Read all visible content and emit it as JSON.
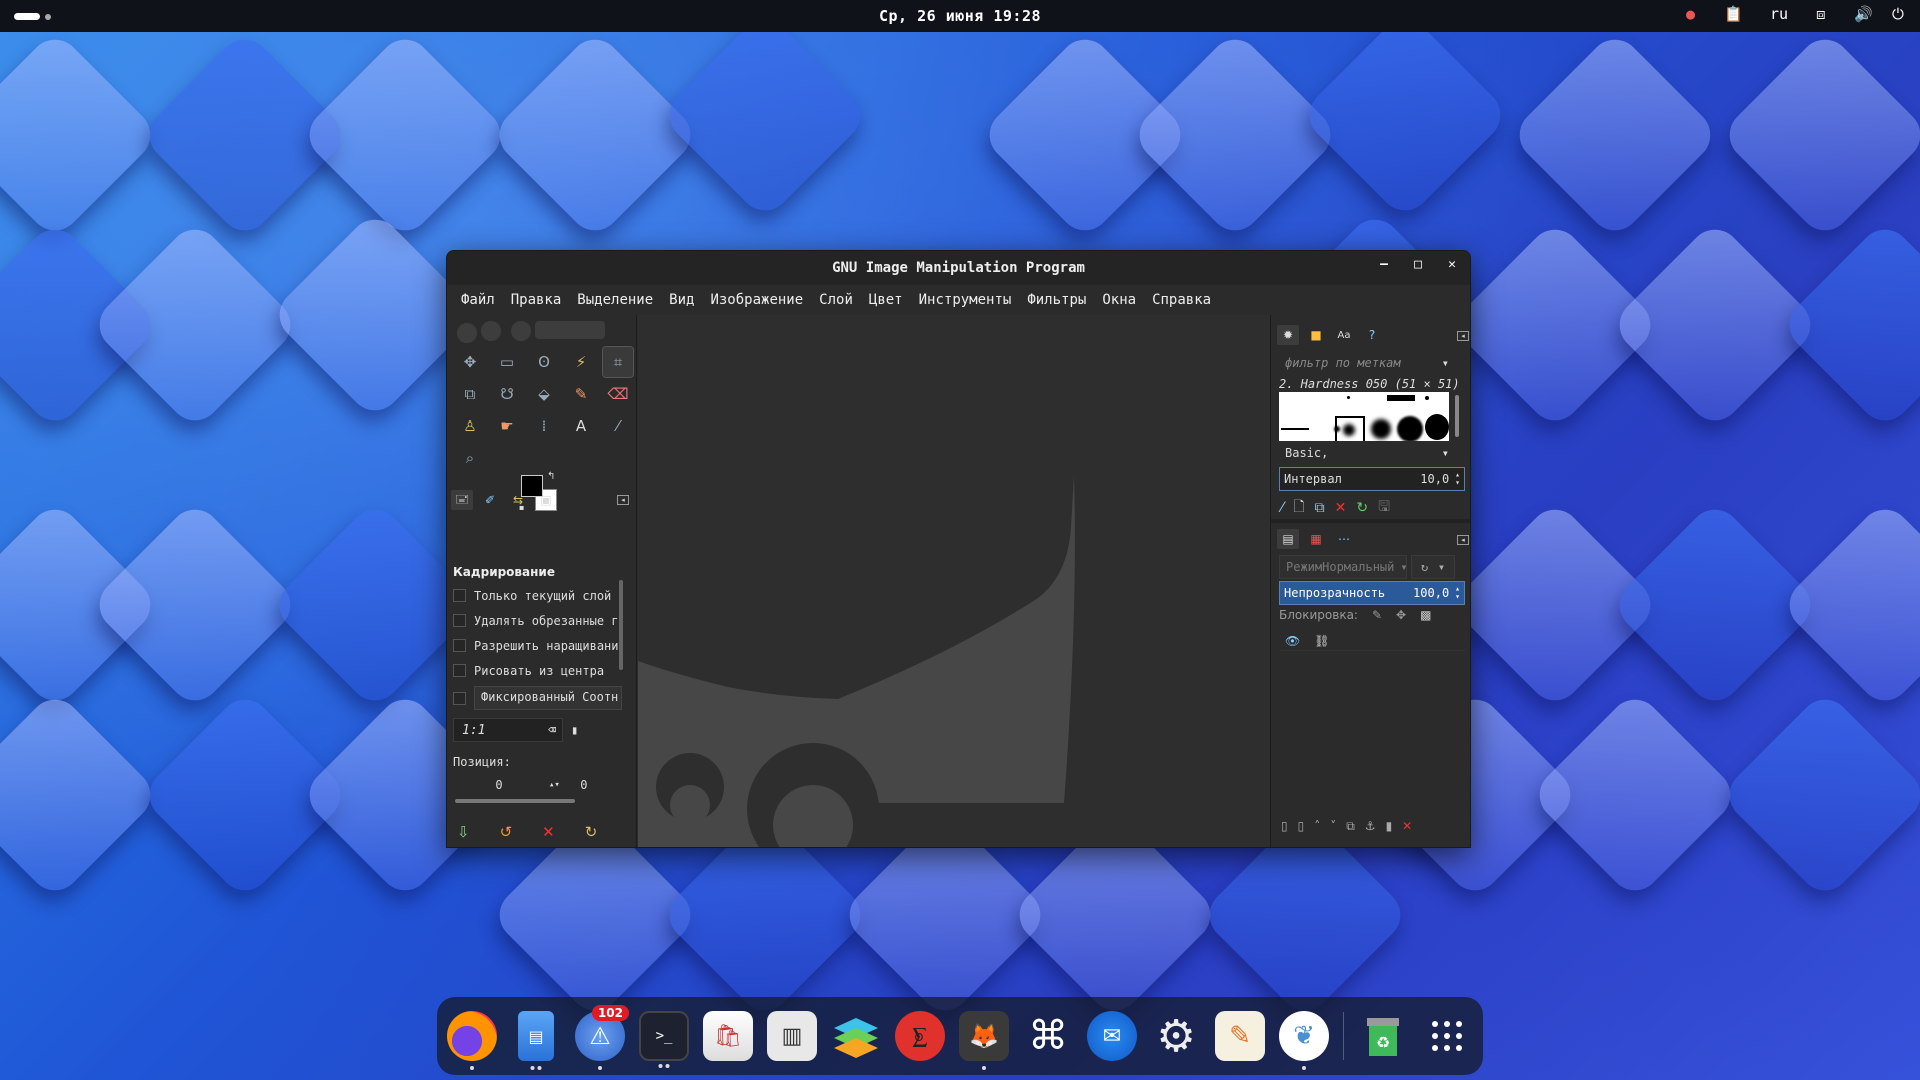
{
  "topbar": {
    "clock": "Ср, 26 июня 19:28",
    "keyboard_layout": "ru"
  },
  "window": {
    "title": "GNU Image Manipulation Program",
    "minimize_label": "–",
    "maximize_label": "□",
    "close_label": "✕"
  },
  "menu": {
    "items": [
      "Файл",
      "Правка",
      "Выделение",
      "Вид",
      "Изображение",
      "Слой",
      "Цвет",
      "Инструменты",
      "Фильтры",
      "Окна",
      "Справка"
    ]
  },
  "tool_options": {
    "title": "Кадрирование",
    "current_layer_only": "Только текущий слой",
    "delete_cropped": "Удалять обрезанные г",
    "allow_growing": "Разрешить наращивани",
    "expand_from_center": "Рисовать из центра",
    "fixed_combo": "Фиксированный Соотн",
    "ratio_value": "1:1",
    "position_label": "Позиция:",
    "pos_x": "0",
    "pos_y": "0"
  },
  "brushes": {
    "filter_placeholder": "фильтр по меткам",
    "current_brush": "2. Hardness 050 (51 × 51)",
    "tag_combo": "Basic,",
    "spacing_label": "Интервал",
    "spacing_value": "10,0"
  },
  "layers": {
    "mode_label": "Режим",
    "mode_value": "Нормальный",
    "opacity_label": "Непрозрачность",
    "opacity_value": "100,0",
    "lock_label": "Блокировка:"
  },
  "dock": {
    "apps": [
      {
        "name": "firefox",
        "icon": "firefox-icon"
      },
      {
        "name": "files",
        "icon": "files-icon"
      },
      {
        "name": "updates",
        "icon": "updates-icon",
        "badge": "102"
      },
      {
        "name": "terminal",
        "icon": "terminal-icon"
      },
      {
        "name": "store",
        "icon": "store-icon"
      },
      {
        "name": "monitor",
        "icon": "system-monitor-icon"
      },
      {
        "name": "layers",
        "icon": "layers-app-icon"
      },
      {
        "name": "app-red",
        "icon": "red-app-icon"
      },
      {
        "name": "gimp",
        "icon": "gimp-icon"
      },
      {
        "name": "screenshot",
        "icon": "screenshot-icon"
      },
      {
        "name": "thunderbird",
        "icon": "thunderbird-icon"
      },
      {
        "name": "settings",
        "icon": "settings-icon"
      },
      {
        "name": "text-editor",
        "icon": "text-editor-icon"
      },
      {
        "name": "coral",
        "icon": "coral-app-icon"
      },
      {
        "name": "trash",
        "icon": "trash-icon"
      },
      {
        "name": "app-grid",
        "icon": "app-grid-icon"
      }
    ]
  }
}
